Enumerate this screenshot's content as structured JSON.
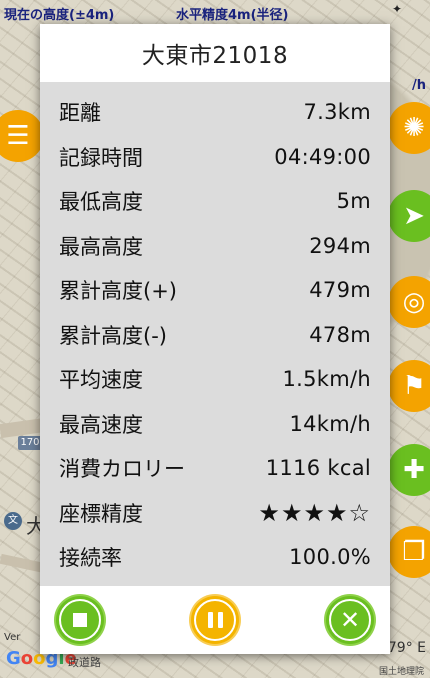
{
  "status_bar": {
    "altitude_label": "現在の高度(±4m)",
    "accuracy_label": "水平精度4m(半径)"
  },
  "map": {
    "route_shield": "170",
    "circle_marker": "文",
    "place_char": "大",
    "version_text": "Ver",
    "google_letters": [
      "G",
      "o",
      "o",
      "g",
      "l",
      "e"
    ],
    "road_label": "政道路",
    "coordinate_text": "79° E",
    "copyright": "国土地理院",
    "unit_fragment": "/h"
  },
  "dialog": {
    "title": "大東市21018",
    "stats": [
      {
        "label": "距離",
        "value": "7.3km"
      },
      {
        "label": "記録時間",
        "value": "04:49:00"
      },
      {
        "label": "最低高度",
        "value": "5m"
      },
      {
        "label": "最高高度",
        "value": "294m"
      },
      {
        "label": "累計高度(+)",
        "value": "479m"
      },
      {
        "label": "累計高度(-)",
        "value": "478m"
      },
      {
        "label": "平均速度",
        "value": "1.5km/h"
      },
      {
        "label": "最高速度",
        "value": "14km/h"
      },
      {
        "label": "消費カロリー",
        "value": "1116 kcal"
      },
      {
        "label": "座標精度",
        "value": "★★★★☆"
      },
      {
        "label": "接続率",
        "value": "100.0%"
      }
    ]
  },
  "footer": {
    "stop_icon": "stop-icon",
    "pause_icon": "pause-icon",
    "close_icon": "close-icon",
    "close_glyph": "✕"
  },
  "colors": {
    "green": "#6abf20",
    "yellow": "#f4b400",
    "status_text": "#1a237e"
  }
}
